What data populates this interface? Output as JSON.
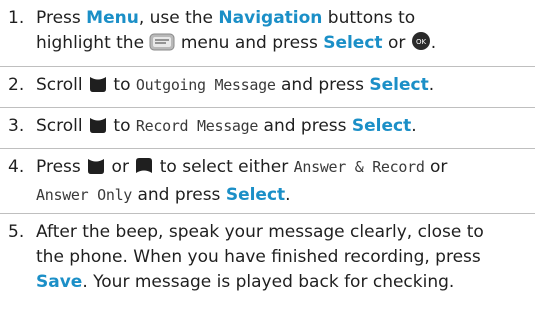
{
  "steps": [
    {
      "number": "1.",
      "line1_before": "Press ",
      "menu": "Menu",
      "line1_mid": ", use the ",
      "navigation": "Navigation",
      "line1_after": " buttons to",
      "line2_before": "highlight the ",
      "line2_mid": " menu and press ",
      "select": "Select",
      "line2_after": " or ",
      "icons": [
        "messages-icon",
        "ok-button-icon"
      ]
    },
    {
      "number": "2.",
      "before": "Scroll ",
      "mid": " to ",
      "lcd": "Outgoing Message",
      "after": " and press ",
      "select": "Select",
      "end": ".",
      "icons": [
        "scroll-down-icon"
      ]
    },
    {
      "number": "3.",
      "before": "Scroll ",
      "mid": " to ",
      "lcd": "Record Message",
      "after": " and press ",
      "select": "Select",
      "end": ".",
      "icons": [
        "scroll-down-icon"
      ]
    },
    {
      "number": "4.",
      "before": "Press ",
      "or": " or ",
      "mid": " to select either ",
      "lcd1": "Answer & Record",
      "or2": " or",
      "lcd2": "Answer Only",
      "after": " and press ",
      "select": "Select",
      "end": ".",
      "icons": [
        "scroll-down-icon",
        "scroll-up-icon"
      ]
    },
    {
      "number": "5.",
      "line1": "After the beep, speak your message clearly, close to",
      "line2": "the phone. When you have finished recording, press",
      "save": "Save",
      "line3_after": ". Your message is played back for checking."
    }
  ],
  "colors": {
    "accent": "#1b8fc7",
    "text": "#1f1f1f",
    "separator": "#bfbfbf"
  }
}
